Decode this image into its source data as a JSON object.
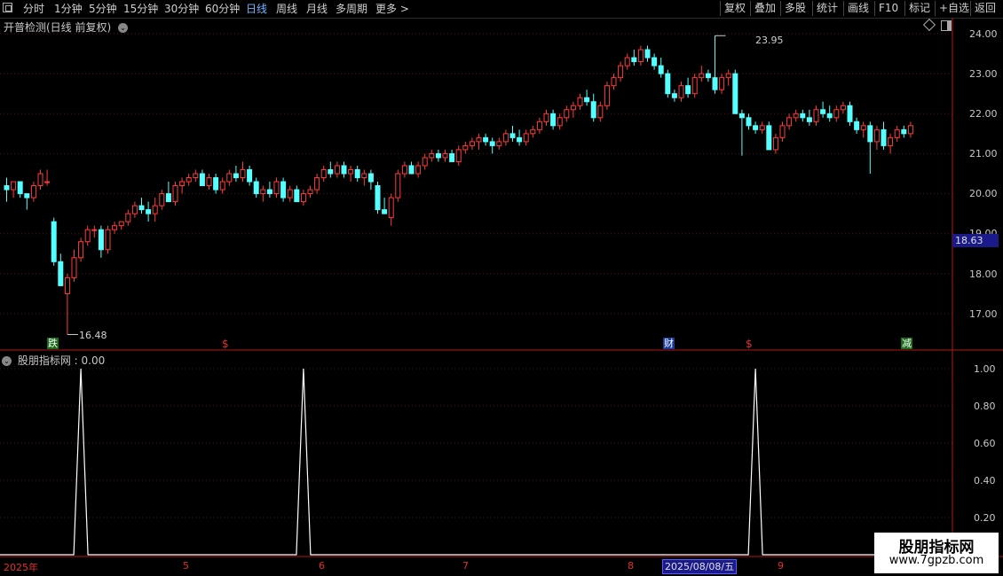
{
  "toolbar": {
    "periods": [
      "分时",
      "1分钟",
      "5分钟",
      "15分钟",
      "30分钟",
      "60分钟",
      "日线",
      "周线",
      "月线",
      "多周期",
      "更多 >"
    ],
    "active_period": "日线",
    "tools": [
      "复权",
      "叠加",
      "多股",
      "统计",
      "画线",
      "F10",
      "标记",
      "+自选",
      "返回"
    ]
  },
  "main_panel": {
    "title": "开普检测(日线 前复权)",
    "y_ticks": [
      "24.00",
      "23.00",
      "22.00",
      "21.00",
      "20.00",
      "19.00",
      "18.00",
      "17.00"
    ],
    "high_label": "23.95",
    "low_label": "16.48",
    "current_price": "18.63",
    "markers": [
      {
        "text": "跌",
        "color": "#1fa21f"
      },
      {
        "text": "$",
        "color": "#e03030"
      },
      {
        "text": "财",
        "color": "#2a6cff"
      },
      {
        "text": "$",
        "color": "#e03030"
      },
      {
        "text": "减",
        "color": "#1fa21f"
      }
    ]
  },
  "indicator_panel": {
    "title": "股朋指标网",
    "value_label": ": 0.00",
    "y_ticks": [
      "1.00",
      "0.80",
      "0.60",
      "0.40",
      "0.20"
    ]
  },
  "x_axis": {
    "labels": [
      "2025年",
      "5",
      "6",
      "7",
      "8",
      "9"
    ],
    "cursor_date": "2025/08/08/五"
  },
  "watermark": {
    "line1": "股朋指标网",
    "line2": "www.7gpzb.com"
  },
  "chart_data": {
    "type": "candlestick",
    "y_range": [
      16.2,
      24.3
    ],
    "up_color": "#ff3c3c",
    "down_color": "#54ffff",
    "candles": [
      [
        20.2,
        20.4,
        19.8,
        20.1
      ],
      [
        20.1,
        20.3,
        19.9,
        20.3
      ],
      [
        20.3,
        20.3,
        19.9,
        20.0
      ],
      [
        20.0,
        20.0,
        19.6,
        19.9
      ],
      [
        19.9,
        20.3,
        19.8,
        20.2
      ],
      [
        20.2,
        20.6,
        20.1,
        20.5
      ],
      [
        20.3,
        20.6,
        20.2,
        20.3
      ],
      [
        19.3,
        19.4,
        18.2,
        18.3
      ],
      [
        18.3,
        18.5,
        17.7,
        17.7
      ],
      [
        17.5,
        18.0,
        16.48,
        17.9
      ],
      [
        17.9,
        18.6,
        17.8,
        18.4
      ],
      [
        18.4,
        18.9,
        18.3,
        18.8
      ],
      [
        18.8,
        19.2,
        18.7,
        19.1
      ],
      [
        19.1,
        19.2,
        18.9,
        19.1
      ],
      [
        19.1,
        19.2,
        18.4,
        18.6
      ],
      [
        18.6,
        19.2,
        18.5,
        19.1
      ],
      [
        19.1,
        19.3,
        19.0,
        19.2
      ],
      [
        19.2,
        19.3,
        19.1,
        19.3
      ],
      [
        19.3,
        19.6,
        19.2,
        19.5
      ],
      [
        19.5,
        19.8,
        19.4,
        19.7
      ],
      [
        19.7,
        19.9,
        19.5,
        19.6
      ],
      [
        19.6,
        19.8,
        19.3,
        19.5
      ],
      [
        19.5,
        19.9,
        19.3,
        19.7
      ],
      [
        19.7,
        20.1,
        19.6,
        20.0
      ],
      [
        20.0,
        20.3,
        19.9,
        19.8
      ],
      [
        19.8,
        20.3,
        19.7,
        20.2
      ],
      [
        20.2,
        20.4,
        20.0,
        20.3
      ],
      [
        20.3,
        20.5,
        20.2,
        20.4
      ],
      [
        20.4,
        20.6,
        20.3,
        20.5
      ],
      [
        20.5,
        20.6,
        20.2,
        20.2
      ],
      [
        20.2,
        20.5,
        20.1,
        20.4
      ],
      [
        20.4,
        20.5,
        20.0,
        20.1
      ],
      [
        20.1,
        20.4,
        20.0,
        20.3
      ],
      [
        20.3,
        20.6,
        20.2,
        20.5
      ],
      [
        20.5,
        20.7,
        20.3,
        20.4
      ],
      [
        20.4,
        20.8,
        20.3,
        20.6
      ],
      [
        20.6,
        20.7,
        20.2,
        20.3
      ],
      [
        20.3,
        20.4,
        19.9,
        20.0
      ],
      [
        20.0,
        20.2,
        19.8,
        20.1
      ],
      [
        20.1,
        20.3,
        19.9,
        20.0
      ],
      [
        20.0,
        20.4,
        19.9,
        20.3
      ],
      [
        20.3,
        20.4,
        19.8,
        19.9
      ],
      [
        19.9,
        20.2,
        19.8,
        20.1
      ],
      [
        20.1,
        20.2,
        19.8,
        19.8
      ],
      [
        19.8,
        20.1,
        19.7,
        20.0
      ],
      [
        20.0,
        20.2,
        19.9,
        20.1
      ],
      [
        20.1,
        20.5,
        20.0,
        20.4
      ],
      [
        20.4,
        20.7,
        20.3,
        20.6
      ],
      [
        20.6,
        20.8,
        20.4,
        20.5
      ],
      [
        20.5,
        20.8,
        20.4,
        20.7
      ],
      [
        20.7,
        20.8,
        20.4,
        20.5
      ],
      [
        20.5,
        20.7,
        20.3,
        20.6
      ],
      [
        20.6,
        20.7,
        20.3,
        20.4
      ],
      [
        20.4,
        20.6,
        20.2,
        20.5
      ],
      [
        20.5,
        20.6,
        20.1,
        20.3
      ],
      [
        20.2,
        20.3,
        19.5,
        19.6
      ],
      [
        19.6,
        19.9,
        19.5,
        19.5
      ],
      [
        19.4,
        20.0,
        19.2,
        19.9
      ],
      [
        19.9,
        20.6,
        19.8,
        20.5
      ],
      [
        20.5,
        20.8,
        20.4,
        20.7
      ],
      [
        20.7,
        20.8,
        20.5,
        20.5
      ],
      [
        20.5,
        20.8,
        20.4,
        20.7
      ],
      [
        20.7,
        21.0,
        20.6,
        20.9
      ],
      [
        20.9,
        21.1,
        20.8,
        21.0
      ],
      [
        21.0,
        21.1,
        20.8,
        20.9
      ],
      [
        20.9,
        21.1,
        20.8,
        21.0
      ],
      [
        21.0,
        21.1,
        20.8,
        20.8
      ],
      [
        20.8,
        21.2,
        20.7,
        21.1
      ],
      [
        21.1,
        21.3,
        21.0,
        21.2
      ],
      [
        21.2,
        21.4,
        21.1,
        21.3
      ],
      [
        21.3,
        21.5,
        21.1,
        21.4
      ],
      [
        21.4,
        21.5,
        21.2,
        21.3
      ],
      [
        21.3,
        21.4,
        21.0,
        21.2
      ],
      [
        21.2,
        21.4,
        21.1,
        21.3
      ],
      [
        21.3,
        21.6,
        21.2,
        21.5
      ],
      [
        21.5,
        21.7,
        21.3,
        21.4
      ],
      [
        21.4,
        21.6,
        21.2,
        21.3
      ],
      [
        21.3,
        21.6,
        21.2,
        21.5
      ],
      [
        21.5,
        21.7,
        21.4,
        21.6
      ],
      [
        21.6,
        21.9,
        21.5,
        21.8
      ],
      [
        21.8,
        22.1,
        21.7,
        22.0
      ],
      [
        22.0,
        22.1,
        21.6,
        21.7
      ],
      [
        21.7,
        22.0,
        21.6,
        21.9
      ],
      [
        21.9,
        22.2,
        21.8,
        22.1
      ],
      [
        22.1,
        22.3,
        21.9,
        22.2
      ],
      [
        22.2,
        22.5,
        22.1,
        22.4
      ],
      [
        22.4,
        22.6,
        22.2,
        22.3
      ],
      [
        22.3,
        22.5,
        21.8,
        21.9
      ],
      [
        21.9,
        22.3,
        21.8,
        22.2
      ],
      [
        22.2,
        22.8,
        22.1,
        22.7
      ],
      [
        22.7,
        23.0,
        22.6,
        22.9
      ],
      [
        22.9,
        23.3,
        22.8,
        23.2
      ],
      [
        23.2,
        23.5,
        23.1,
        23.4
      ],
      [
        23.4,
        23.6,
        23.2,
        23.3
      ],
      [
        23.3,
        23.7,
        23.2,
        23.6
      ],
      [
        23.6,
        23.7,
        23.3,
        23.4
      ],
      [
        23.4,
        23.5,
        23.1,
        23.2
      ],
      [
        23.2,
        23.4,
        22.9,
        23.0
      ],
      [
        23.0,
        23.1,
        22.4,
        22.5
      ],
      [
        22.5,
        22.6,
        22.3,
        22.4
      ],
      [
        22.4,
        22.8,
        22.3,
        22.7
      ],
      [
        22.7,
        22.9,
        22.4,
        22.5
      ],
      [
        22.5,
        23.0,
        22.4,
        22.9
      ],
      [
        22.9,
        23.2,
        22.8,
        23.0
      ],
      [
        23.0,
        23.1,
        22.8,
        22.9
      ],
      [
        22.9,
        23.95,
        22.5,
        22.6
      ],
      [
        22.6,
        23.0,
        22.5,
        22.9
      ],
      [
        22.9,
        23.1,
        22.7,
        23.0
      ],
      [
        23.0,
        23.1,
        22.0,
        22.0
      ],
      [
        22.0,
        22.1,
        20.95,
        21.9
      ],
      [
        21.9,
        22.0,
        21.6,
        21.7
      ],
      [
        21.7,
        21.8,
        21.5,
        21.6
      ],
      [
        21.6,
        21.8,
        21.5,
        21.7
      ],
      [
        21.7,
        21.8,
        21.1,
        21.1
      ],
      [
        21.1,
        21.5,
        21.0,
        21.4
      ],
      [
        21.4,
        21.8,
        21.3,
        21.7
      ],
      [
        21.7,
        22.0,
        21.6,
        21.9
      ],
      [
        21.9,
        22.1,
        21.8,
        22.0
      ],
      [
        22.0,
        22.1,
        21.8,
        21.9
      ],
      [
        21.9,
        22.1,
        21.7,
        21.8
      ],
      [
        21.8,
        22.2,
        21.7,
        22.1
      ],
      [
        22.1,
        22.3,
        21.9,
        22.0
      ],
      [
        22.0,
        22.2,
        21.8,
        21.9
      ],
      [
        21.9,
        22.2,
        21.8,
        22.1
      ],
      [
        22.1,
        22.3,
        22.0,
        22.2
      ],
      [
        22.2,
        22.3,
        21.7,
        21.8
      ],
      [
        21.8,
        21.9,
        21.5,
        21.6
      ],
      [
        21.6,
        21.8,
        21.4,
        21.7
      ],
      [
        21.7,
        21.8,
        20.5,
        21.3
      ],
      [
        21.3,
        21.7,
        21.1,
        21.6
      ],
      [
        21.6,
        21.8,
        21.1,
        21.2
      ],
      [
        21.2,
        21.5,
        21.0,
        21.4
      ],
      [
        21.4,
        21.7,
        21.3,
        21.6
      ],
      [
        21.6,
        21.7,
        21.4,
        21.5
      ],
      [
        21.5,
        21.8,
        21.4,
        21.7
      ]
    ],
    "indicator": {
      "type": "line",
      "y_range": [
        0,
        1
      ],
      "spikes_at_candle_index": [
        11,
        44,
        111
      ],
      "spike_value": 1.0,
      "baseline": 0.0,
      "color": "#ffffff"
    }
  }
}
